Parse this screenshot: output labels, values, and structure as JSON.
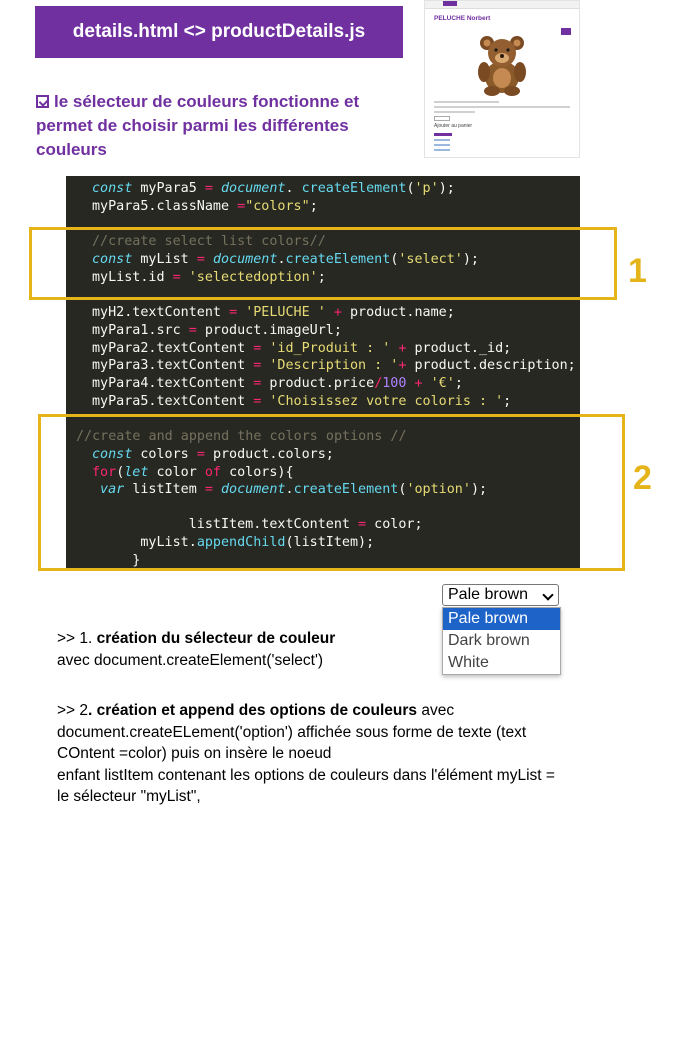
{
  "header": {
    "title": "details.html <>  productDetails.js"
  },
  "checklist": {
    "text": "le sélecteur de couleurs fonctionne et permet de choisir parmi les différentes couleurs"
  },
  "preview": {
    "product_title": "PELUCHE Norbert",
    "add_to_cart": "Ajouter au panier"
  },
  "code": {
    "lines": [
      [
        [
          "kw",
          "const "
        ],
        [
          "",
          "myPara5 "
        ],
        [
          "op",
          "= "
        ],
        [
          "kw",
          "document"
        ],
        [
          "",
          ". "
        ],
        [
          "fn",
          "createElement"
        ],
        [
          "",
          "("
        ],
        [
          "str",
          "'p'"
        ],
        [
          "",
          ");"
        ]
      ],
      [
        [
          "",
          "myPara5.className "
        ],
        [
          "op",
          "="
        ],
        [
          "str",
          "\"colors\""
        ],
        [
          "",
          ";"
        ]
      ],
      [],
      [
        [
          "cm",
          "//create select list colors//"
        ]
      ],
      [
        [
          "kw",
          "const "
        ],
        [
          "",
          "myList "
        ],
        [
          "op",
          "= "
        ],
        [
          "kw",
          "document"
        ],
        [
          "",
          "."
        ],
        [
          "fn",
          "createElement"
        ],
        [
          "",
          "("
        ],
        [
          "str",
          "'select'"
        ],
        [
          "",
          ");"
        ]
      ],
      [
        [
          "",
          "myList.id "
        ],
        [
          "op",
          "= "
        ],
        [
          "str",
          "'selectedoption'"
        ],
        [
          "",
          ";"
        ]
      ],
      [],
      [
        [
          "",
          "myH2.textContent "
        ],
        [
          "op",
          "= "
        ],
        [
          "str",
          "'PELUCHE ' "
        ],
        [
          "op",
          "+ "
        ],
        [
          "",
          "product.name;"
        ]
      ],
      [
        [
          "",
          "myPara1.src "
        ],
        [
          "op",
          "= "
        ],
        [
          "",
          "product.imageUrl;"
        ]
      ],
      [
        [
          "",
          "myPara2.textContent "
        ],
        [
          "op",
          "= "
        ],
        [
          "str",
          "'id_Produit : ' "
        ],
        [
          "op",
          "+ "
        ],
        [
          "",
          "product._id;"
        ]
      ],
      [
        [
          "",
          "myPara3.textContent "
        ],
        [
          "op",
          "= "
        ],
        [
          "str",
          "'Description : '"
        ],
        [
          "op",
          "+ "
        ],
        [
          "",
          "product.description;"
        ]
      ],
      [
        [
          "",
          "myPara4.textContent "
        ],
        [
          "op",
          "= "
        ],
        [
          "",
          "product.price"
        ],
        [
          "op",
          "/"
        ],
        [
          "num",
          "100 "
        ],
        [
          "op",
          "+ "
        ],
        [
          "str",
          "'€'"
        ],
        [
          "",
          ";"
        ]
      ],
      [
        [
          "",
          "myPara5.textContent "
        ],
        [
          "op",
          "= "
        ],
        [
          "str",
          "'Choisissez votre coloris : '"
        ],
        [
          "",
          ";"
        ]
      ],
      [],
      [
        [
          "cm",
          "//create and append the colors options //"
        ]
      ],
      [
        [
          "kw",
          "const "
        ],
        [
          "",
          "colors "
        ],
        [
          "op",
          "= "
        ],
        [
          "",
          "product.colors;"
        ]
      ],
      [
        [
          "op",
          "for"
        ],
        [
          "",
          "("
        ],
        [
          "kw",
          "let "
        ],
        [
          "",
          "color "
        ],
        [
          "op",
          "of "
        ],
        [
          "",
          "colors){"
        ]
      ],
      [
        [
          "kw",
          " var "
        ],
        [
          "",
          "listItem "
        ],
        [
          "op",
          "= "
        ],
        [
          "kw",
          "document"
        ],
        [
          "",
          "."
        ],
        [
          "fn",
          "createElement"
        ],
        [
          "",
          "("
        ],
        [
          "str",
          "'option'"
        ],
        [
          "",
          ");"
        ]
      ],
      [],
      [
        [
          "",
          "            listItem.textContent "
        ],
        [
          "op",
          "= "
        ],
        [
          "",
          "color;"
        ]
      ],
      [
        [
          "",
          "      myList."
        ],
        [
          "fn",
          "appendChild"
        ],
        [
          "",
          "(listItem);"
        ]
      ],
      [
        [
          "",
          "     }"
        ]
      ]
    ]
  },
  "annotations": {
    "label1": "1",
    "label2": "2"
  },
  "select": {
    "selected": "Pale brown",
    "options": [
      "Pale brown",
      "Dark brown",
      "White"
    ]
  },
  "para1": {
    "prefix": ">>  1. ",
    "bold": "création du sélecteur de couleur",
    "line2": "avec document.createElement('select')"
  },
  "para2": {
    "prefix": ">> 2",
    "bold": ". création  et append des options de couleurs",
    "after": " avec",
    "line2": "document.createELement('option') affichée sous forme de texte (text",
    "line3": "COntent =color) puis on insère le noeud",
    "line4": " enfant listItem contenant les options de couleurs dans l'élément myList =",
    "line5": "le sélecteur \"myList\","
  },
  "colors": {
    "purple": "#7030a0",
    "frame": "#e4b419",
    "code_bg": "#272822",
    "select_highlight": "#1e64c8"
  }
}
